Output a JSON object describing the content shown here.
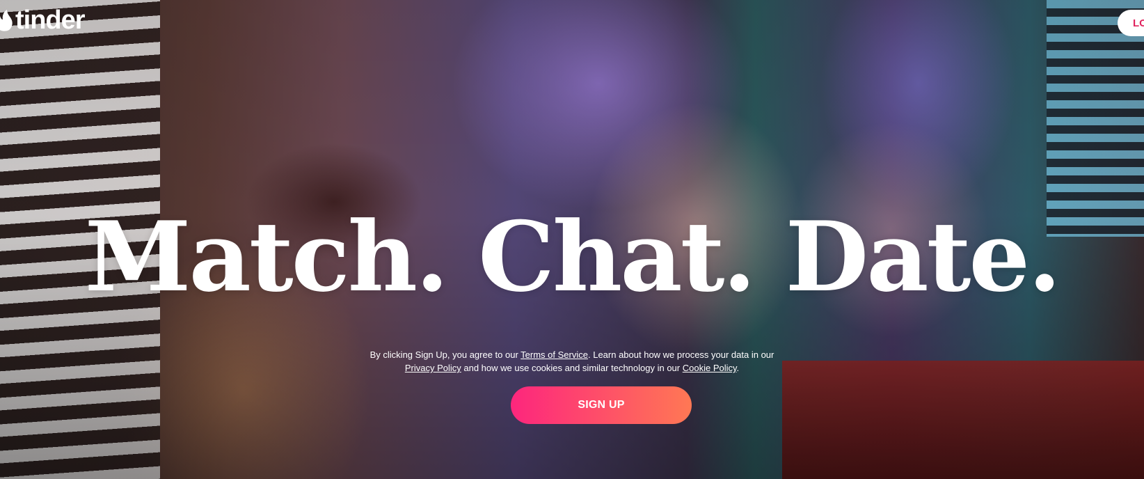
{
  "header": {
    "logo_text": "tinder",
    "login_label": "LO"
  },
  "hero": {
    "headline": "Match. Chat. Date.",
    "legal": {
      "part1": "By clicking Sign Up, you agree to our ",
      "terms_link": "Terms of Service",
      "part2": ". Learn about how we process your data in our ",
      "privacy_link": "Privacy Policy",
      "part3": " and how we use cookies and similar technology in our ",
      "cookie_link": "Cookie Policy",
      "part4": "."
    },
    "signup_label": "SIGN UP"
  },
  "colors": {
    "accent_gradient_start": "#fd267d",
    "accent_gradient_end": "#ff7854",
    "text": "#ffffff"
  }
}
